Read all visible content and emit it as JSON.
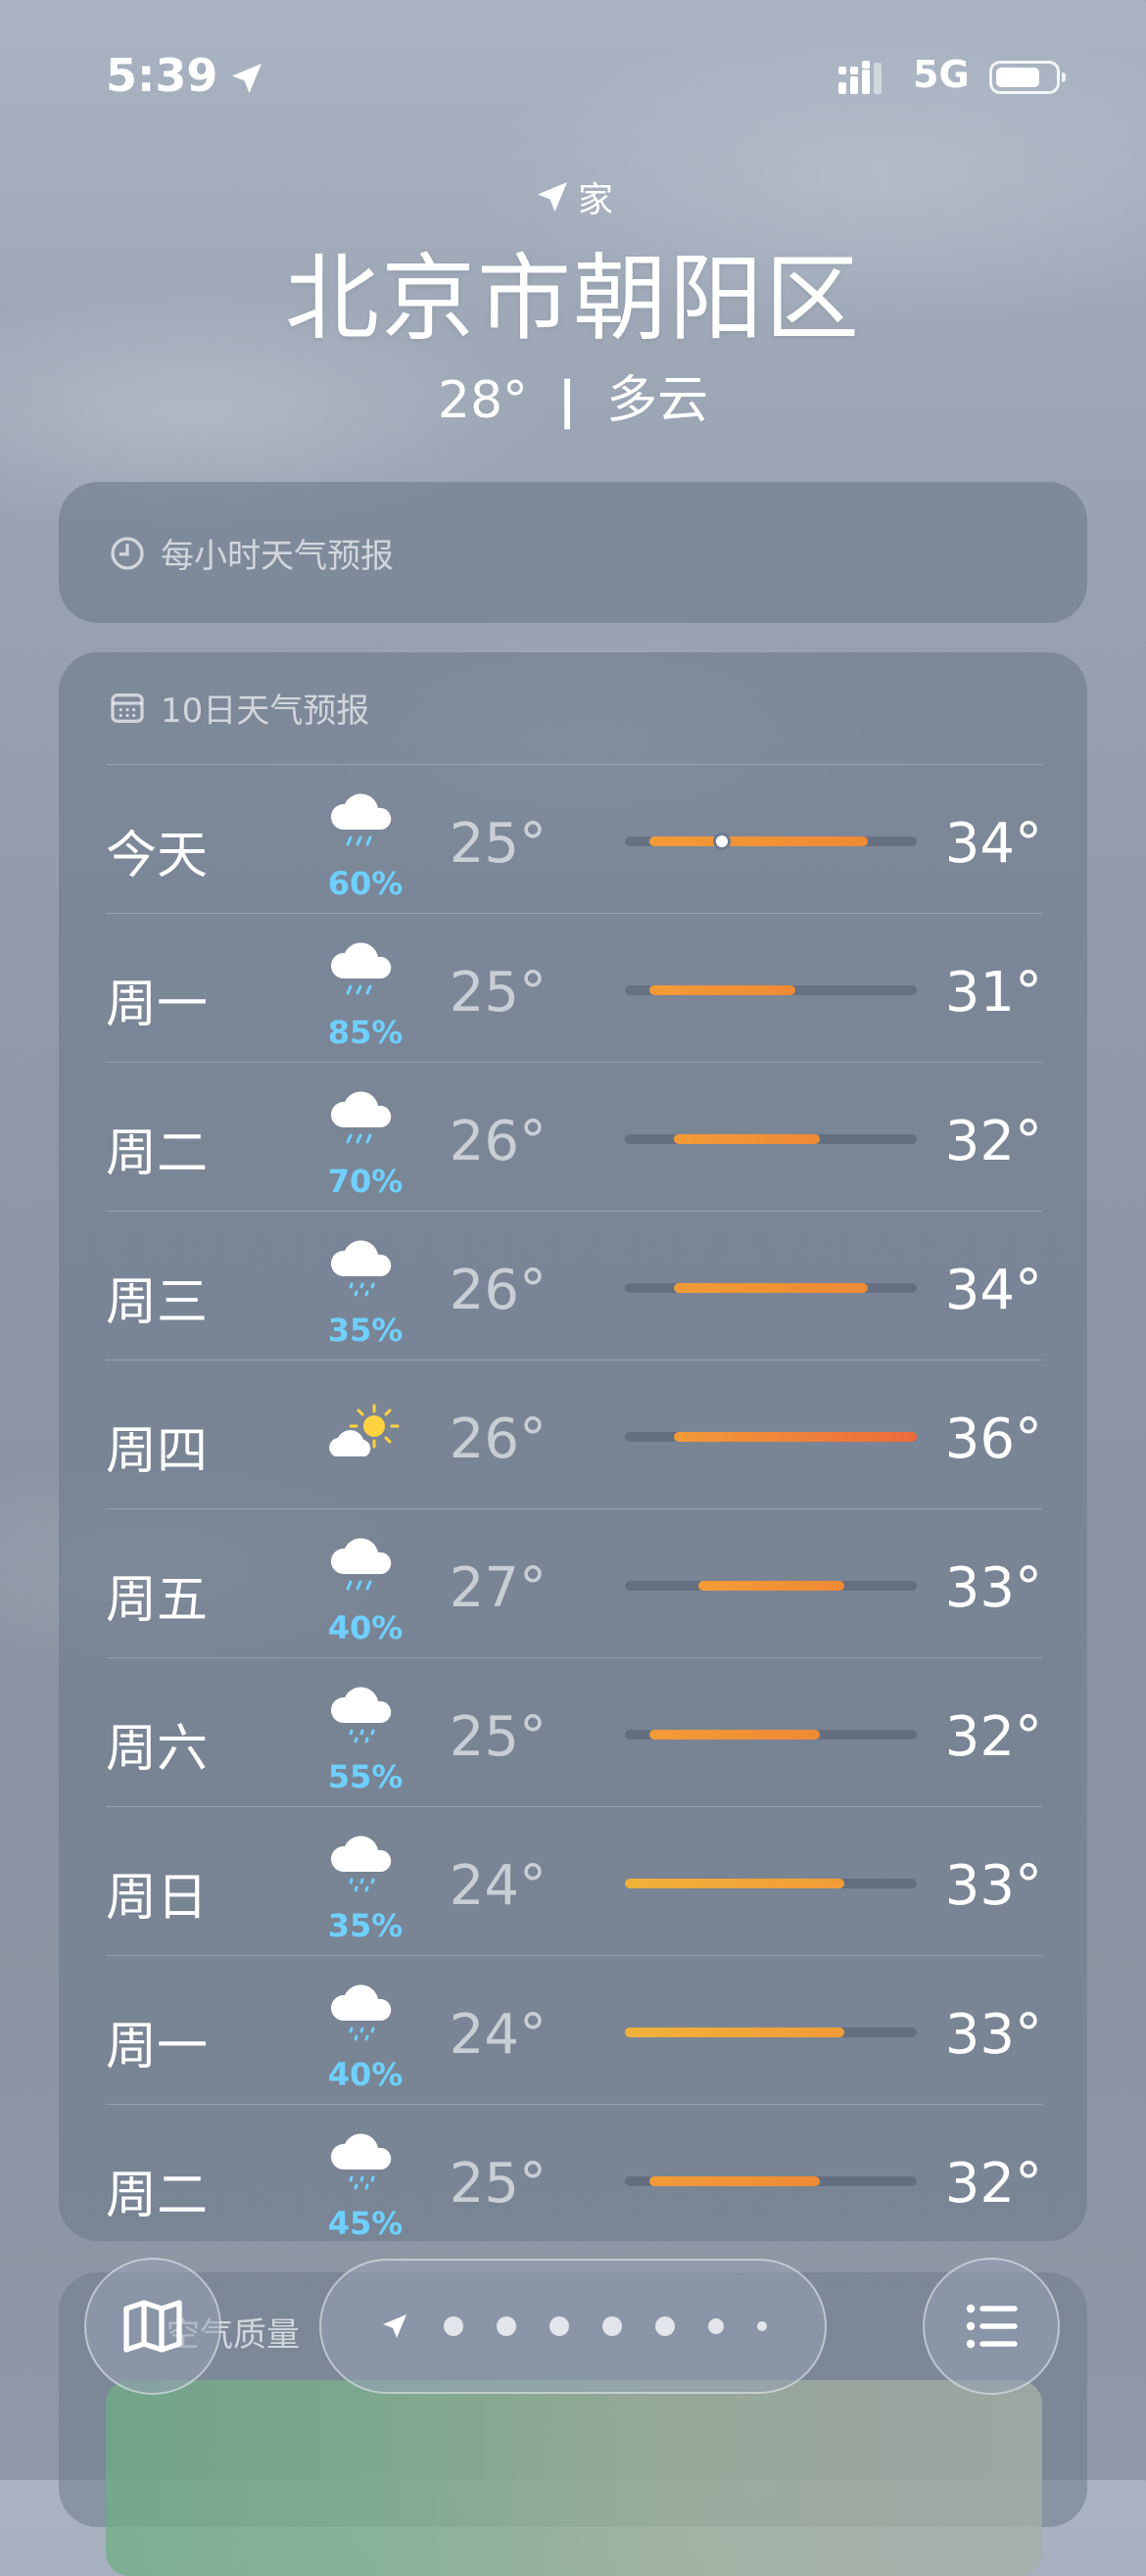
{
  "status_bar": {
    "time": "5:39",
    "network": "5G"
  },
  "header": {
    "location_label": "家",
    "city": "北京市朝阳区",
    "temperature": "28°",
    "separator": "|",
    "condition": "多云"
  },
  "hourly": {
    "title": "每小时天气预报"
  },
  "forecast": {
    "title": "10日天气预报",
    "days": [
      {
        "day": "今天",
        "icon": "cloud-rain-icon",
        "precip": "60%",
        "low": "25°",
        "high": "34°"
      },
      {
        "day": "周一",
        "icon": "cloud-rain-icon",
        "precip": "85%",
        "low": "25°",
        "high": "31°"
      },
      {
        "day": "周二",
        "icon": "cloud-rain-icon",
        "precip": "70%",
        "low": "26°",
        "high": "32°"
      },
      {
        "day": "周三",
        "icon": "cloud-drizzle-icon",
        "precip": "35%",
        "low": "26°",
        "high": "34°"
      },
      {
        "day": "周四",
        "icon": "partly-sunny-icon",
        "precip": "",
        "low": "26°",
        "high": "36°"
      },
      {
        "day": "周五",
        "icon": "cloud-rain-icon",
        "precip": "40%",
        "low": "27°",
        "high": "33°"
      },
      {
        "day": "周六",
        "icon": "cloud-drizzle-icon",
        "precip": "55%",
        "low": "25°",
        "high": "32°"
      },
      {
        "day": "周日",
        "icon": "cloud-drizzle-icon",
        "precip": "35%",
        "low": "24°",
        "high": "33°"
      },
      {
        "day": "周一",
        "icon": "cloud-drizzle-icon",
        "precip": "40%",
        "low": "24°",
        "high": "33°"
      },
      {
        "day": "周二",
        "icon": "cloud-drizzle-icon",
        "precip": "45%",
        "low": "25°",
        "high": "32°"
      }
    ],
    "current_temp": 28,
    "scale_min": 24,
    "scale_max": 36
  },
  "air_quality": {
    "title": "空气质量"
  },
  "colors": {
    "precip": "#6fd0ff",
    "bar_warm": "#f29b38",
    "bar_hot": "#ec6a3c",
    "bar_mild": "#f0b23a"
  }
}
